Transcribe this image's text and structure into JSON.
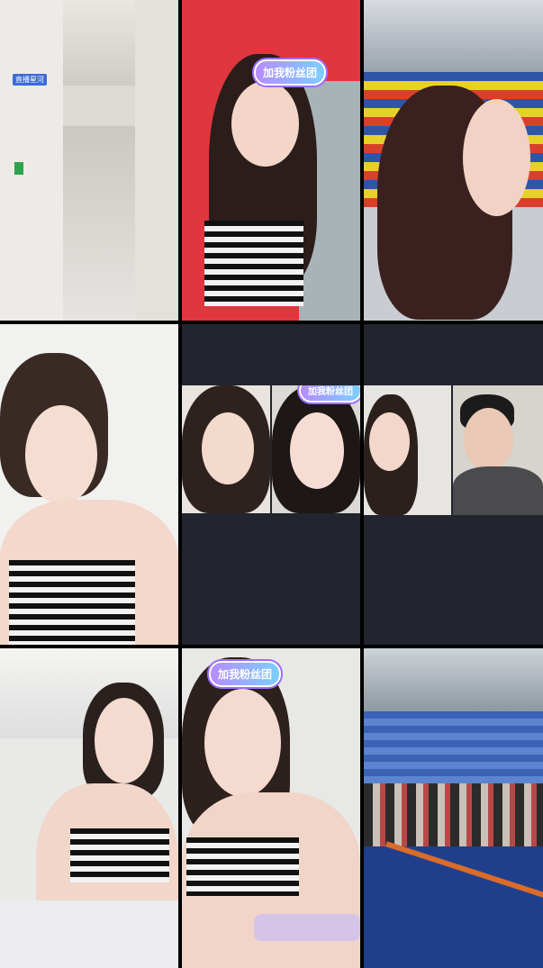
{
  "tiles": {
    "t4": {
      "badge": "加我粉丝团"
    },
    "t6": {
      "badge": "加我粉丝团"
    },
    "t9": {
      "badge": "加我粉丝团"
    }
  },
  "t1": {
    "label": "直播星河"
  }
}
